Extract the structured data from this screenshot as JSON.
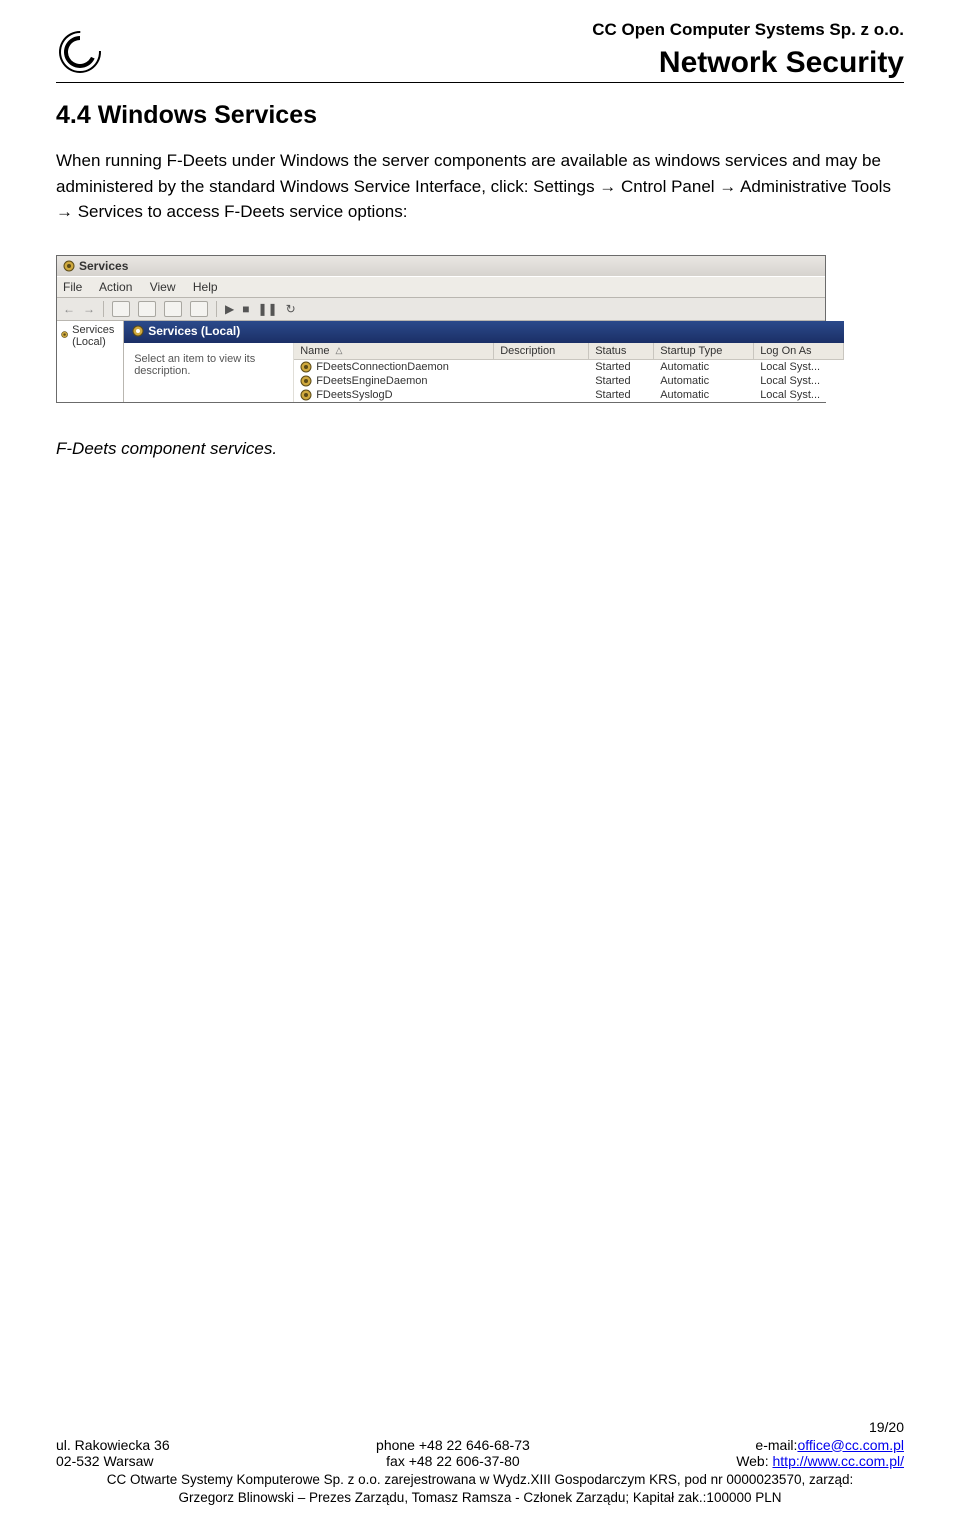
{
  "header": {
    "company": "CC Open Computer Systems Sp. z o.o.",
    "title": "Network Security"
  },
  "section": {
    "heading": "4.4 Windows Services",
    "paragraph": "When running F-Deets under Windows the server components are available as windows services and may be administered by the standard Windows Service Interface,  click: Settings → Cntrol Panel → Administrative Tools → Services to access F-Deets service options:"
  },
  "screenshot": {
    "window_title": "Services",
    "menu": [
      "File",
      "Action",
      "View",
      "Help"
    ],
    "tree_item": "Services (Local)",
    "pane_title": "Services (Local)",
    "desc_hint": "Select an item to view its description.",
    "columns": [
      "Name",
      "Description",
      "Status",
      "Startup Type",
      "Log On As"
    ],
    "rows": [
      {
        "name": "FDeetsConnectionDaemon",
        "description": "",
        "status": "Started",
        "startup": "Automatic",
        "logon": "Local Syst..."
      },
      {
        "name": "FDeetsEngineDaemon",
        "description": "",
        "status": "Started",
        "startup": "Automatic",
        "logon": "Local Syst..."
      },
      {
        "name": "FDeetsSyslogD",
        "description": "",
        "status": "Started",
        "startup": "Automatic",
        "logon": "Local Syst..."
      }
    ]
  },
  "caption": "F-Deets component services.",
  "footer": {
    "page": "19/20",
    "left1": "ul. Rakowiecka 36",
    "left2": "02-532 Warsaw",
    "mid1": "phone +48 22 646-68-73",
    "mid2": "fax +48 22 606-37-80",
    "right1_label": "e-mail:",
    "right1_link": "office@cc.com.pl",
    "right2_label": "Web: ",
    "right2_link": "http://www.cc.com.pl/",
    "legal1": "CC Otwarte Systemy Komputerowe Sp. z o.o. zarejestrowana w Wydz.XIII Gospodarczym KRS, pod nr 0000023570, zarząd:",
    "legal2": "Grzegorz Blinowski – Prezes Zarządu, Tomasz Ramsza - Członek Zarządu; Kapitał zak.:100000 PLN"
  }
}
